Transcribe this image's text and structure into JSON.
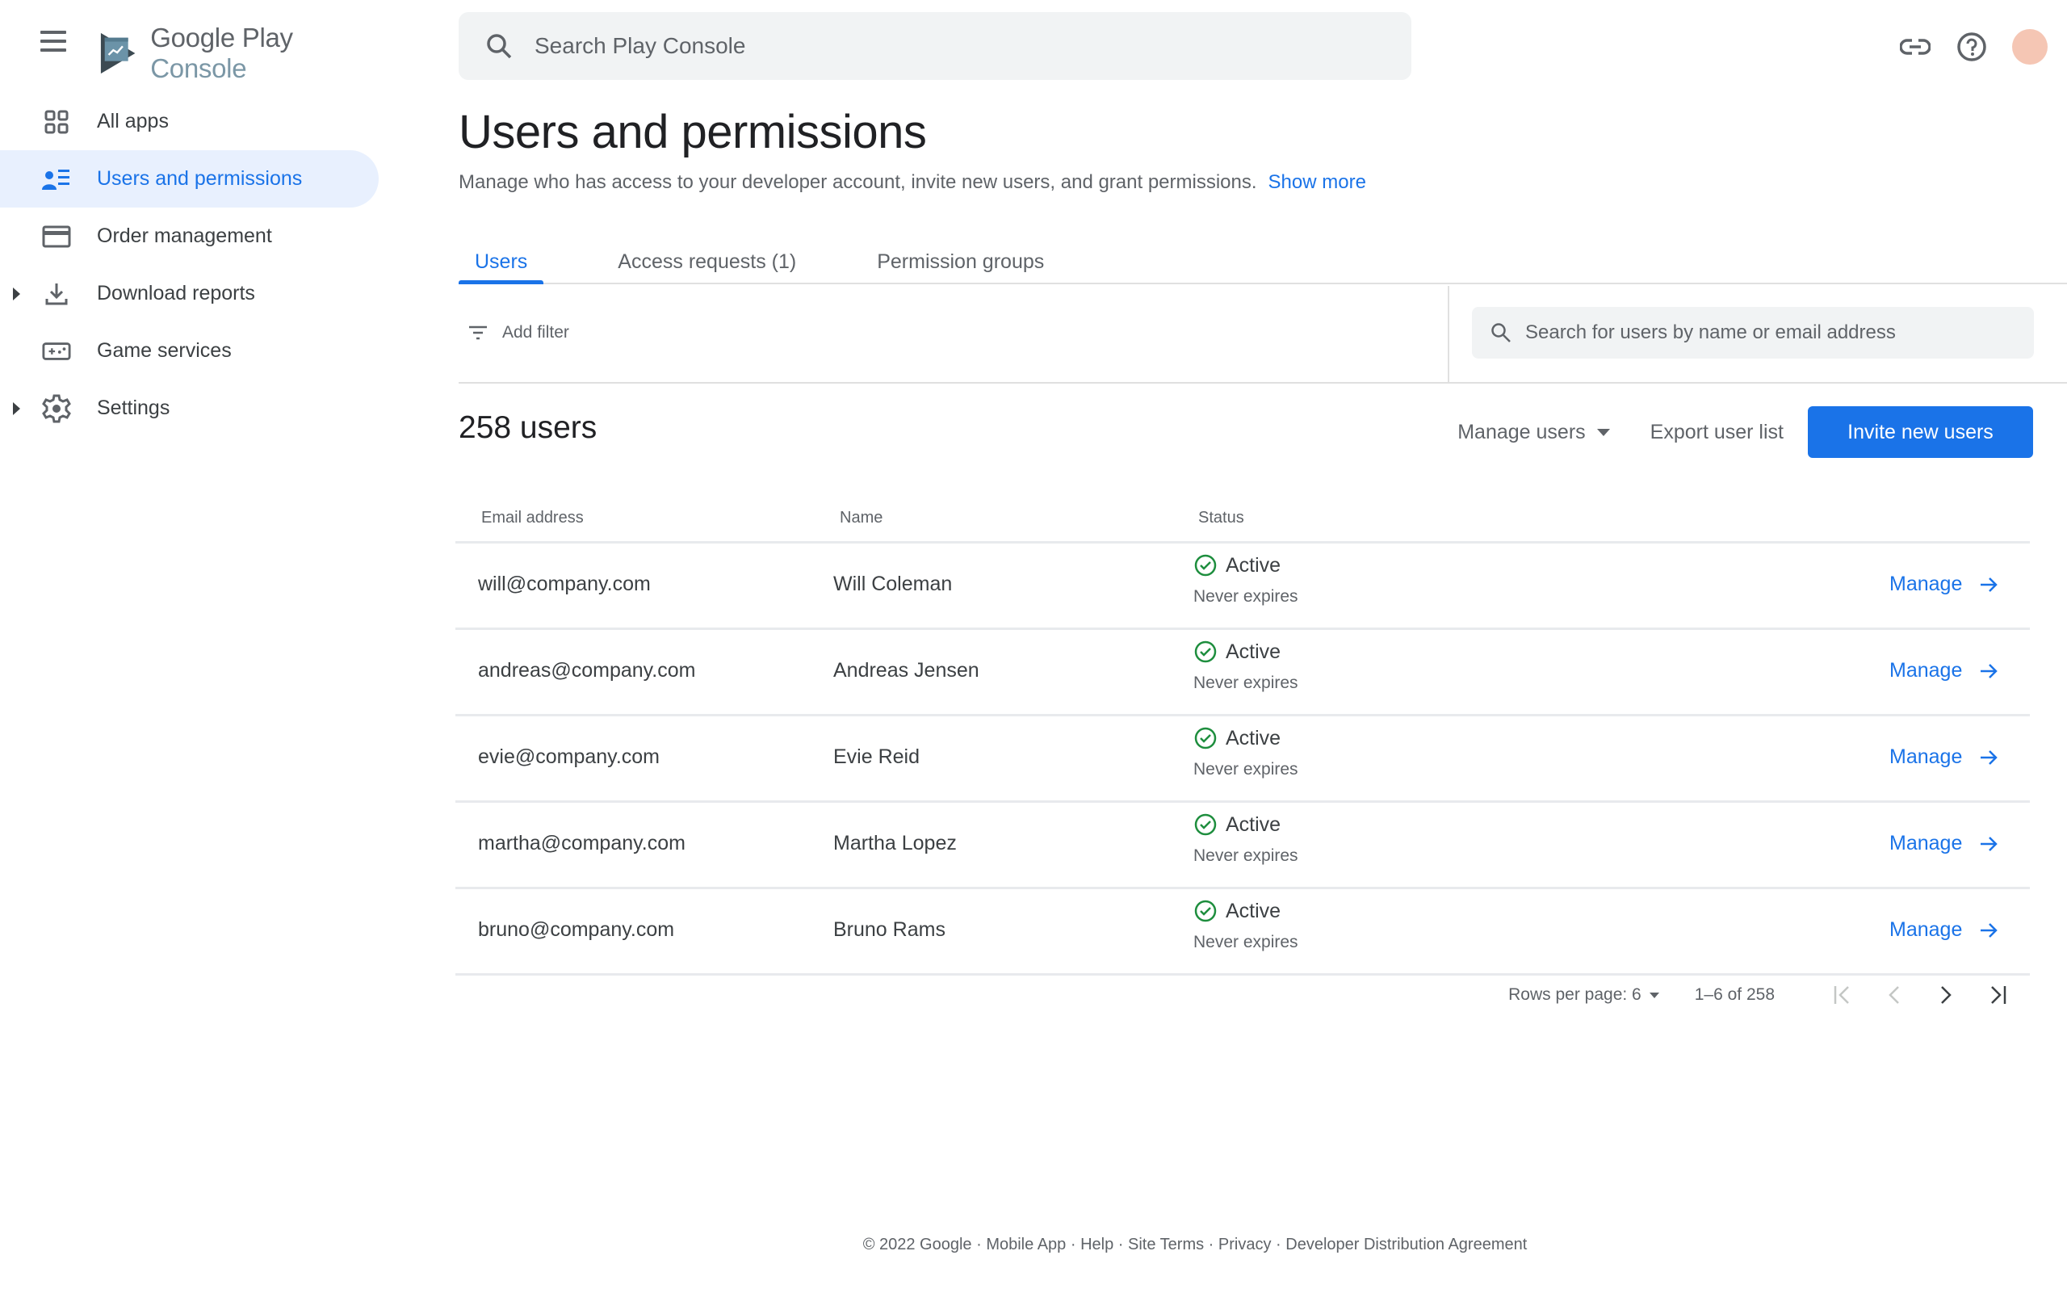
{
  "app": {
    "logo_text_primary": "Google Play",
    "logo_text_secondary": "Console"
  },
  "topbar": {
    "search_placeholder": "Search Play Console",
    "icons": [
      "link-icon",
      "help-icon",
      "account-avatar"
    ]
  },
  "sidebar": {
    "items": [
      {
        "label": "All apps",
        "icon": "grid-icon",
        "active": false,
        "expandable": false
      },
      {
        "label": "Users and permissions",
        "icon": "users-list-icon",
        "active": true,
        "expandable": false
      },
      {
        "label": "Order management",
        "icon": "credit-card-icon",
        "active": false,
        "expandable": false
      },
      {
        "label": "Download reports",
        "icon": "download-icon",
        "active": false,
        "expandable": true
      },
      {
        "label": "Game services",
        "icon": "gamepad-icon",
        "active": false,
        "expandable": false
      },
      {
        "label": "Settings",
        "icon": "gear-icon",
        "active": false,
        "expandable": true
      }
    ]
  },
  "page": {
    "title": "Users and permissions",
    "description": "Manage who has access to your developer account, invite new users, and grant permissions.",
    "show_more": "Show more"
  },
  "tabs": [
    {
      "label": "Users",
      "active": true
    },
    {
      "label": "Access requests (1)",
      "active": false
    },
    {
      "label": "Permission groups",
      "active": false
    }
  ],
  "filter": {
    "add_filter_label": "Add filter",
    "search_placeholder": "Search for users by name or email address"
  },
  "users_header": {
    "count_label": "258 users",
    "manage_users": "Manage users",
    "export_user_list": "Export user list",
    "invite_new_users": "Invite new users"
  },
  "table": {
    "columns": [
      "Email address",
      "Name",
      "Status"
    ],
    "rows": [
      {
        "email": "will@company.com",
        "name": "Will Coleman",
        "status": "Active",
        "expiry": "Never expires",
        "action": "Manage"
      },
      {
        "email": "andreas@company.com",
        "name": "Andreas Jensen",
        "status": "Active",
        "expiry": "Never expires",
        "action": "Manage"
      },
      {
        "email": "evie@company.com",
        "name": "Evie Reid",
        "status": "Active",
        "expiry": "Never expires",
        "action": "Manage"
      },
      {
        "email": "martha@company.com",
        "name": "Martha Lopez",
        "status": "Active",
        "expiry": "Never expires",
        "action": "Manage"
      },
      {
        "email": "bruno@company.com",
        "name": "Bruno Rams",
        "status": "Active",
        "expiry": "Never expires",
        "action": "Manage"
      }
    ]
  },
  "pagination": {
    "rows_per_page_label": "Rows per page: 6",
    "range_label": "1–6 of 258"
  },
  "footer": {
    "copyright": "© 2022 Google",
    "links": [
      "Mobile App",
      "Help",
      "Site Terms",
      "Privacy",
      "Developer Distribution Agreement"
    ]
  },
  "colors": {
    "accent": "#1a73e8",
    "active_nav_bg": "#e8f0fe",
    "status_active": "#1e8e3e",
    "text_secondary": "#5f6368"
  }
}
